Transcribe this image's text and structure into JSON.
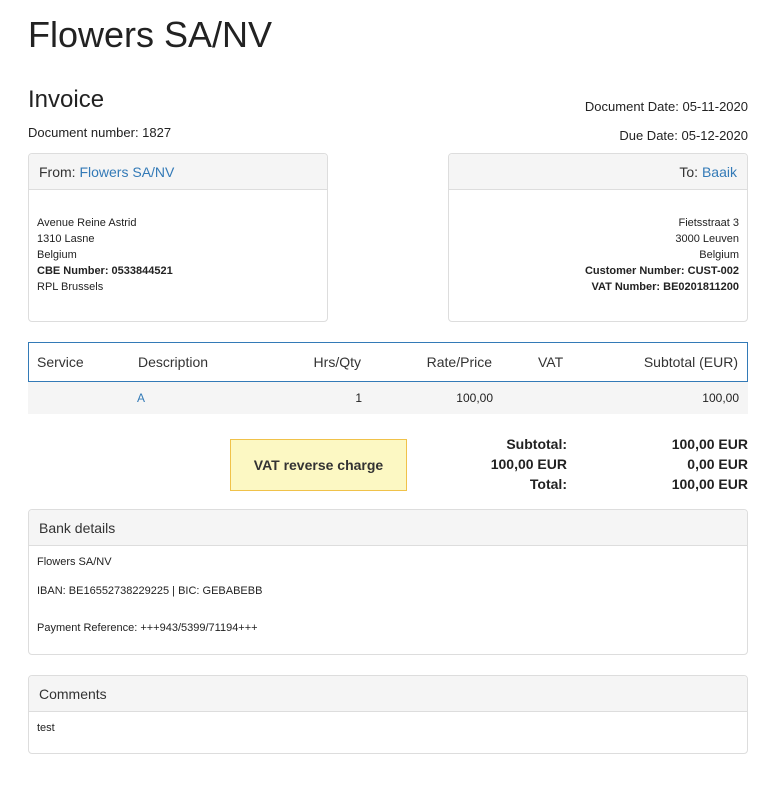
{
  "company_name": "Flowers SA/NV",
  "invoice": {
    "title": "Invoice",
    "document_number": "Document number: 1827",
    "document_date": "Document Date: 05-11-2020",
    "due_date": "Due Date: 05-12-2020"
  },
  "from": {
    "label": "From:",
    "name": "Flowers SA/NV",
    "lines": [
      "Avenue Reine Astrid",
      "1310 Lasne",
      "Belgium"
    ],
    "cbe_label": "CBE Number: 0533844521",
    "rpl": "RPL Brussels"
  },
  "to": {
    "label": "To:",
    "name": "Baaik",
    "lines": [
      "Fietsstraat 3",
      "3000 Leuven",
      "Belgium"
    ],
    "customer_number": "Customer Number: CUST-002",
    "vat_number": "VAT Number: BE0201811200"
  },
  "items": {
    "headers": {
      "service": "Service",
      "description": "Description",
      "qty": "Hrs/Qty",
      "rate": "Rate/Price",
      "vat": "VAT",
      "subtotal": "Subtotal (EUR)"
    },
    "rows": [
      {
        "service": "",
        "description": "A",
        "qty": "1",
        "rate": "100,00",
        "vat": "",
        "subtotal": "100,00"
      }
    ]
  },
  "vat_note": "VAT reverse charge",
  "totals": {
    "subtotal_label": "Subtotal:",
    "subtotal_value": "100,00 EUR",
    "vat_label": "100,00 EUR",
    "vat_value": "0,00 EUR",
    "total_label": "Total:",
    "total_value": "100,00 EUR"
  },
  "bank": {
    "title": "Bank details",
    "name": "Flowers SA/NV",
    "iban": "IBAN: BE16552738229225 | BIC: GEBABEBB",
    "payment_reference": "Payment Reference: +++943/5399/71194+++"
  },
  "comments": {
    "title": "Comments",
    "text": "test"
  }
}
